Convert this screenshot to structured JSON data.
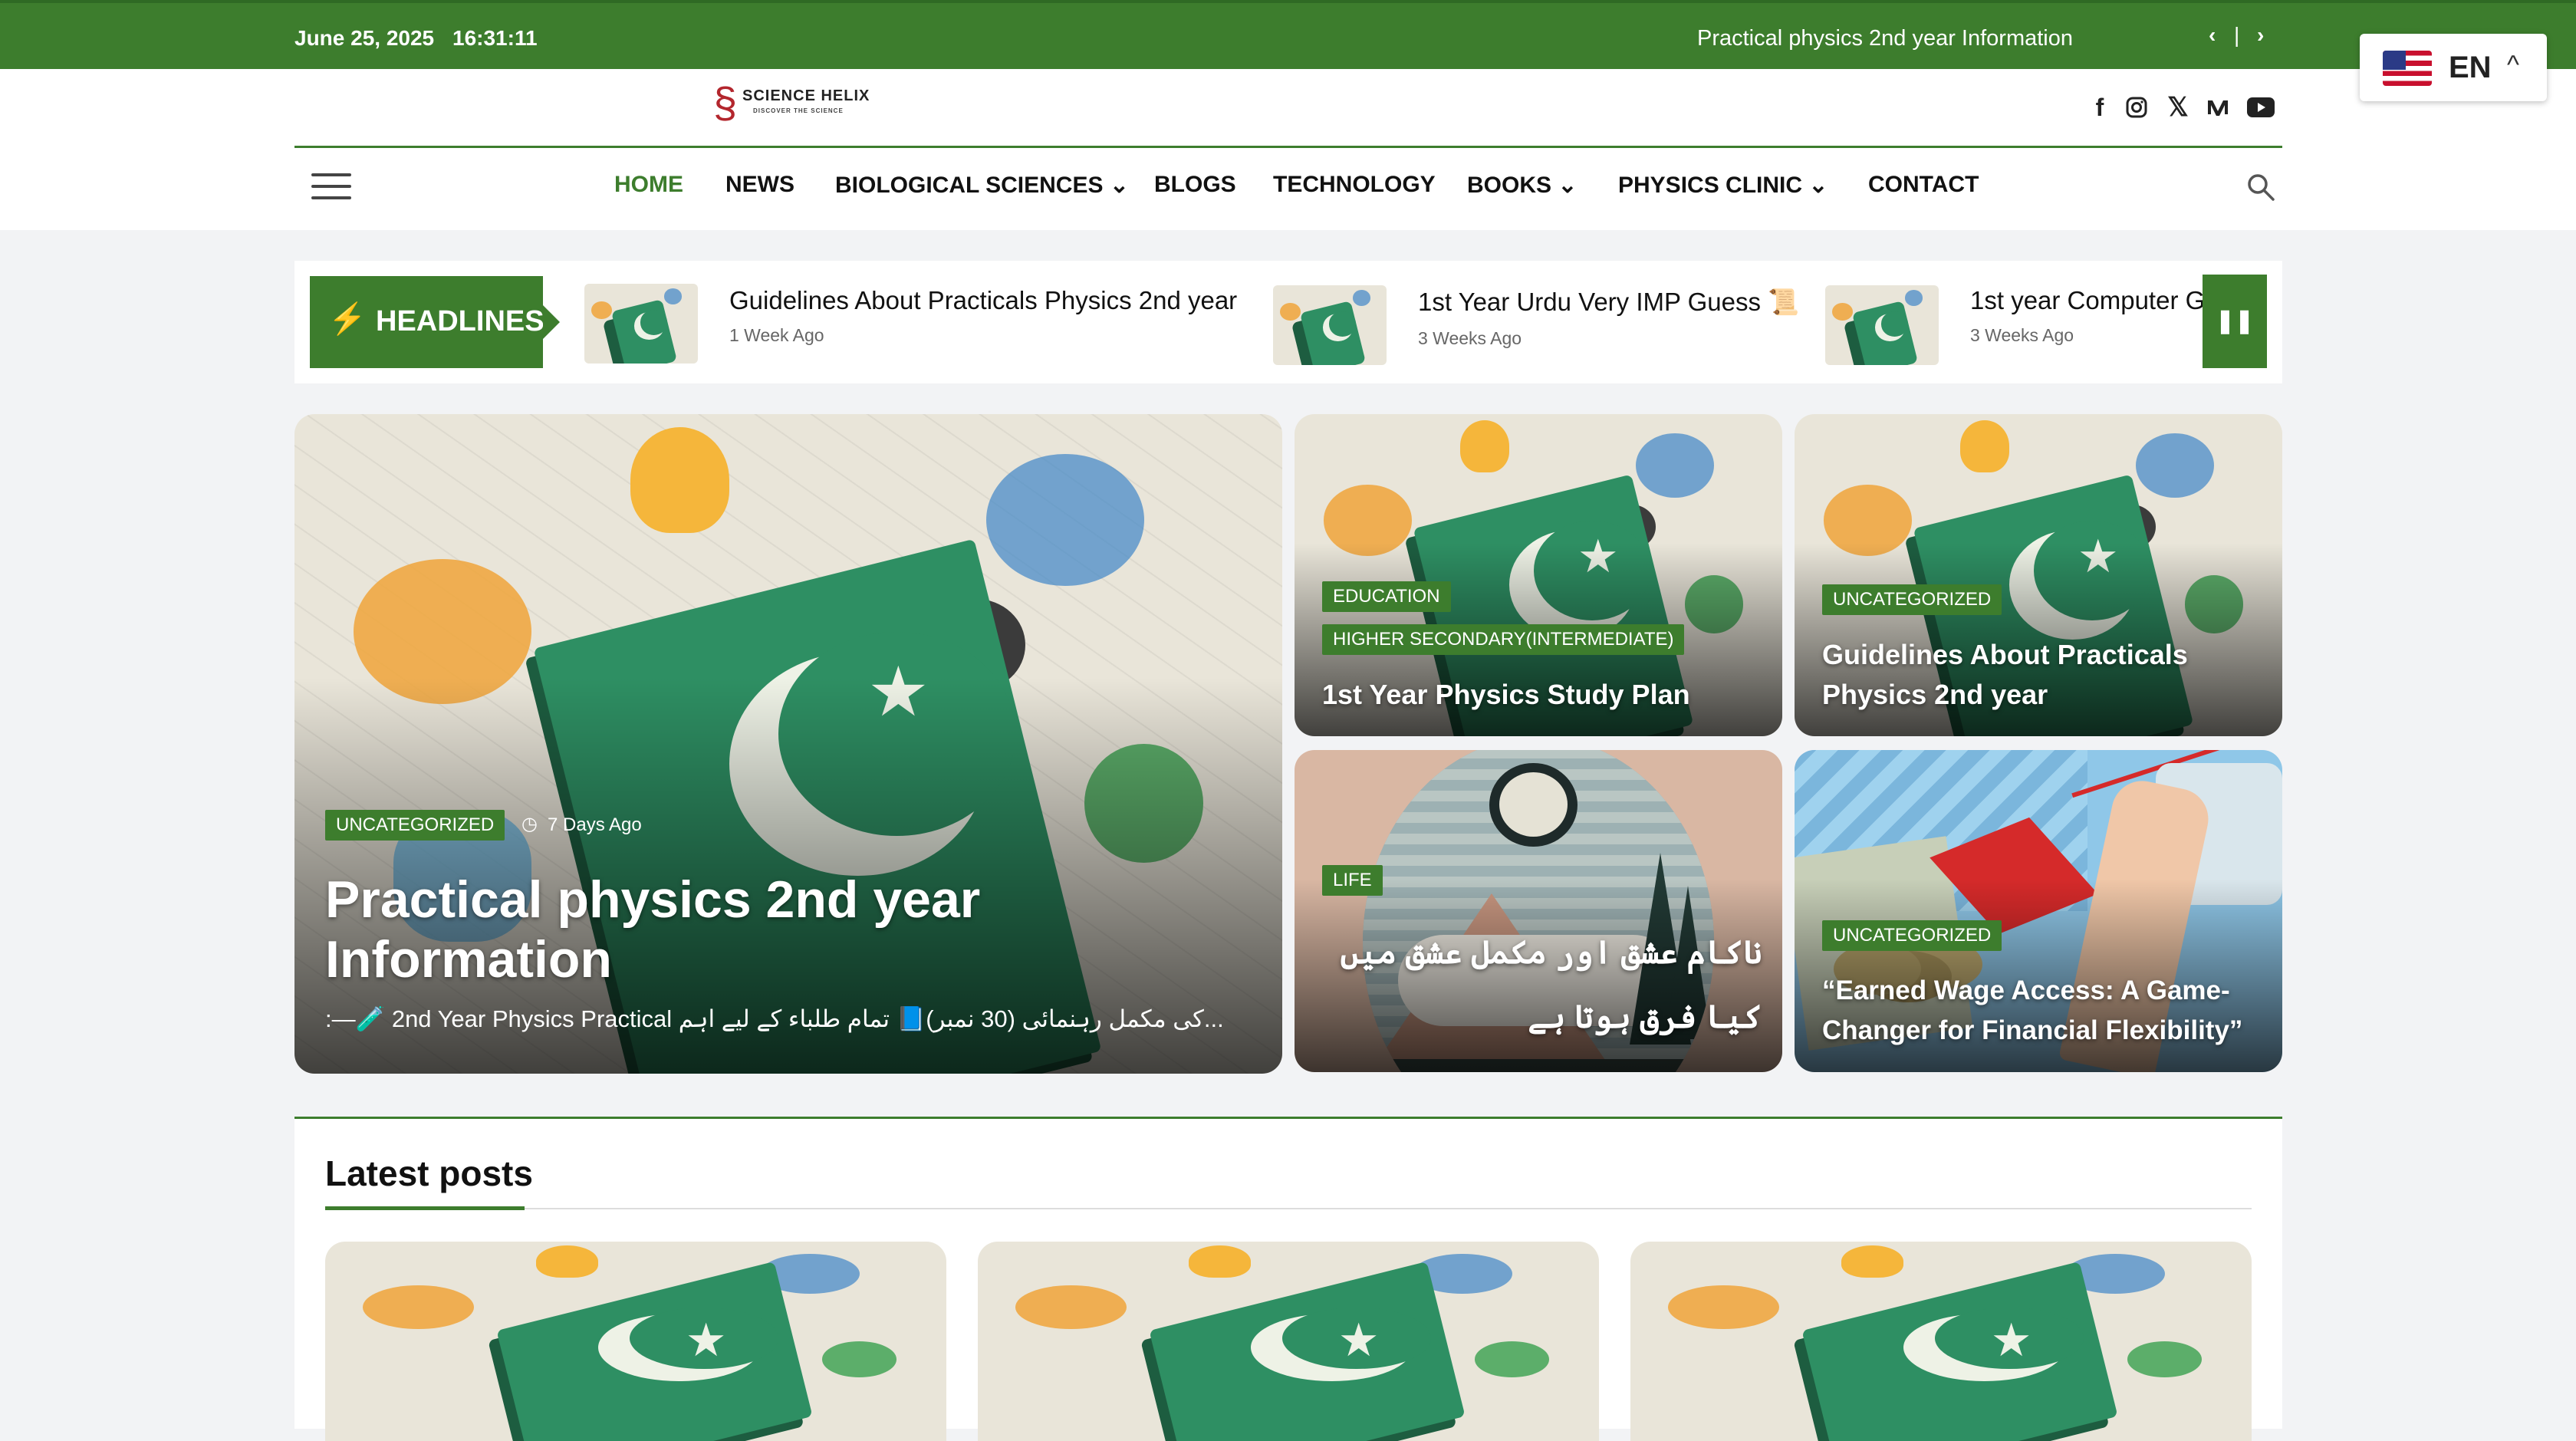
{
  "topbar": {
    "date": "June 25, 2025",
    "time": "16:31:11",
    "ticker": "Practical physics 2nd year Information",
    "prev": "‹",
    "sep": "|",
    "next": "›"
  },
  "language": {
    "code": "EN",
    "caret": "^"
  },
  "brand": {
    "name": "SCIENCE HELIX",
    "tagline": "DISCOVER THE SCIENCE"
  },
  "social": [
    "facebook-icon",
    "instagram-icon",
    "x-icon",
    "medium-icon",
    "youtube-icon"
  ],
  "nav": {
    "items": [
      {
        "label": "HOME",
        "active": true
      },
      {
        "label": "NEWS"
      },
      {
        "label": "BIOLOGICAL SCIENCES",
        "dropdown": true
      },
      {
        "label": "BLOGS"
      },
      {
        "label": "TECHNOLOGY"
      },
      {
        "label": "BOOKS",
        "dropdown": true
      },
      {
        "label": "PHYSICS CLINIC",
        "dropdown": true
      },
      {
        "label": "CONTACT"
      }
    ],
    "dropdown_caret": "⌄"
  },
  "headlines": {
    "label": "HEADLINES",
    "items": [
      {
        "title": "Guidelines About Practicals Physics 2nd year",
        "age": "1 Week Ago"
      },
      {
        "title": "1st Year Urdu Very IMP Guess 📜",
        "age": "3 Weeks Ago"
      },
      {
        "title": "1st year Computer Gu",
        "age": "3 Weeks Ago"
      }
    ]
  },
  "featured": {
    "main": {
      "category": "UNCATEGORIZED",
      "age": "7 Days Ago",
      "title": "Practical physics 2nd year Information",
      "excerpt": ":—🧪 2nd Year Physics Practical کی مکمل رہنمائی (30 نمبر)📘 تمام طلباء کے لیے اہم..."
    },
    "cards": [
      {
        "categories": [
          "EDUCATION",
          "HIGHER SECONDARY(INTERMEDIATE)"
        ],
        "title": "1st Year Physics Study Plan"
      },
      {
        "categories": [
          "UNCATEGORIZED"
        ],
        "title": "Guidelines About Practicals Physics 2nd year"
      },
      {
        "categories": [
          "LIFE"
        ],
        "title": "ناکام عشق اور مکمل عشق میں کیا فرق ہوتا ہے"
      },
      {
        "categories": [
          "UNCATEGORIZED"
        ],
        "title": "“Earned Wage Access: A Game-Changer for Financial Flexibility”"
      }
    ]
  },
  "latest": {
    "title": "Latest posts"
  },
  "colors": {
    "accent": "#3d7d2d",
    "topbar": "#3d7d2d"
  }
}
